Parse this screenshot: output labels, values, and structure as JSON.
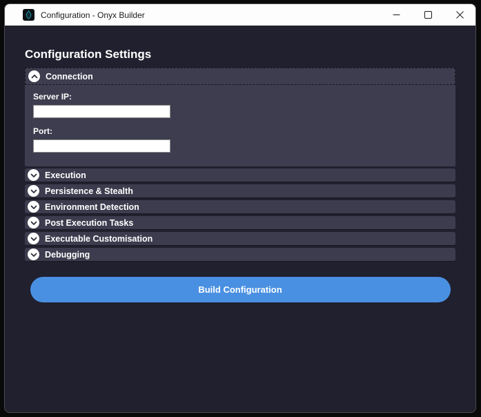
{
  "window": {
    "title": "Configuration - Onyx Builder",
    "app_icon": "onyx-flame-icon",
    "controls": [
      {
        "name": "minimize",
        "icon": "minimize-icon"
      },
      {
        "name": "maximize",
        "icon": "maximize-icon"
      },
      {
        "name": "close",
        "icon": "close-icon"
      }
    ]
  },
  "page": {
    "heading": "Configuration Settings",
    "build_button_label": "Build Configuration"
  },
  "sections": [
    {
      "label": "Connection",
      "state": "expanded",
      "icon": "chevron-up-icon"
    },
    {
      "label": "Execution",
      "state": "collapsed",
      "icon": "chevron-down-icon"
    },
    {
      "label": "Persistence & Stealth",
      "state": "collapsed",
      "icon": "chevron-down-icon"
    },
    {
      "label": "Environment Detection",
      "state": "collapsed",
      "icon": "chevron-down-icon"
    },
    {
      "label": "Post Execution Tasks",
      "state": "collapsed",
      "icon": "chevron-down-icon"
    },
    {
      "label": "Executable Customisation",
      "state": "collapsed",
      "icon": "chevron-down-icon"
    },
    {
      "label": "Debugging",
      "state": "collapsed",
      "icon": "chevron-down-icon"
    }
  ],
  "connection_fields": [
    {
      "label": "Server IP:",
      "value": ""
    },
    {
      "label": "Port:",
      "value": ""
    }
  ],
  "colors": {
    "outer_background": "#0a0a0a",
    "titlebar_background": "#fdfdfd",
    "titlebar_text": "#1b1b1b",
    "body_background": "#20202e",
    "panel_background": "#3d3d4f",
    "accent_blue": "#4a90e2",
    "icon_teal": "#1d8a9e",
    "text": "#ffffff"
  }
}
